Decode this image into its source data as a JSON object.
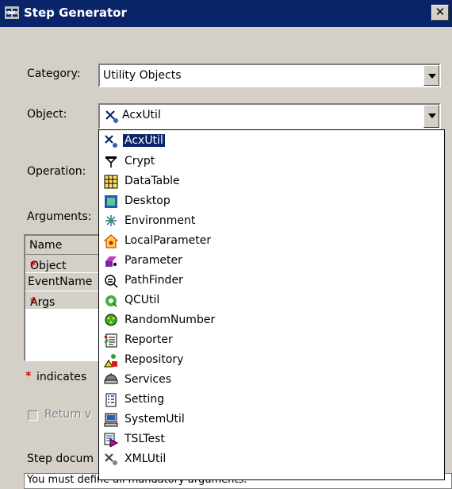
{
  "window": {
    "title": "Step Generator",
    "close_glyph": "✕"
  },
  "form": {
    "category_label": "Category:",
    "category_value": "Utility Objects",
    "object_label": "Object:",
    "object_value": "AcxUtil",
    "operation_label": "Operation:",
    "arguments_label": "Arguments:",
    "grid_header": "Name",
    "grid_rows": [
      {
        "name": "Object",
        "required": true
      },
      {
        "name": "EventName",
        "required": false
      },
      {
        "name": "Args",
        "required": true
      }
    ],
    "required_mark": "*",
    "indicates_text": "indicates",
    "return_label": "Return v",
    "step_doc_label": "Step docum",
    "doc_text": "You must define all mandatory arguments."
  },
  "dropdown": {
    "selected_index": 0,
    "items": [
      {
        "label": "AcxUtil",
        "icon": "acxutil-icon"
      },
      {
        "label": "Crypt",
        "icon": "crypt-icon"
      },
      {
        "label": "DataTable",
        "icon": "datatable-icon"
      },
      {
        "label": "Desktop",
        "icon": "desktop-icon"
      },
      {
        "label": "Environment",
        "icon": "environment-icon"
      },
      {
        "label": "LocalParameter",
        "icon": "local-parameter-icon"
      },
      {
        "label": "Parameter",
        "icon": "parameter-icon"
      },
      {
        "label": "PathFinder",
        "icon": "pathfinder-icon"
      },
      {
        "label": "QCUtil",
        "icon": "qcutil-icon"
      },
      {
        "label": "RandomNumber",
        "icon": "random-number-icon"
      },
      {
        "label": "Reporter",
        "icon": "reporter-icon"
      },
      {
        "label": "Repository",
        "icon": "repository-icon"
      },
      {
        "label": "Services",
        "icon": "services-icon"
      },
      {
        "label": "Setting",
        "icon": "setting-icon"
      },
      {
        "label": "SystemUtil",
        "icon": "systemutil-icon"
      },
      {
        "label": "TSLTest",
        "icon": "tsltest-icon"
      },
      {
        "label": "XMLUtil",
        "icon": "xmlutil-icon"
      }
    ]
  }
}
